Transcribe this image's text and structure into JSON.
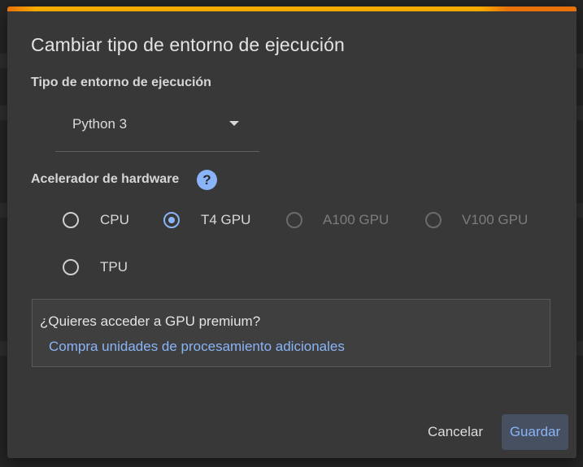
{
  "dialog": {
    "title": "Cambiar tipo de entorno de ejecución",
    "runtime_section_label": "Tipo de entorno de ejecución",
    "runtime_select_value": "Python 3",
    "hardware_section_label": "Acelerador de hardware",
    "help_icon_glyph": "?",
    "accelerators": [
      {
        "label": "CPU",
        "selected": false,
        "disabled": false
      },
      {
        "label": "T4 GPU",
        "selected": true,
        "disabled": false
      },
      {
        "label": "A100 GPU",
        "selected": false,
        "disabled": true
      },
      {
        "label": "V100 GPU",
        "selected": false,
        "disabled": true
      },
      {
        "label": "TPU",
        "selected": false,
        "disabled": false
      }
    ],
    "premium": {
      "question": "¿Quieres acceder a GPU premium?",
      "link": "Compra unidades de procesamiento adicionales"
    },
    "buttons": {
      "cancel": "Cancelar",
      "save": "Guardar"
    }
  },
  "colors": {
    "accent": "#8ab4f8",
    "dialog_bg": "#383838",
    "top_bar": "#f9ab00"
  }
}
